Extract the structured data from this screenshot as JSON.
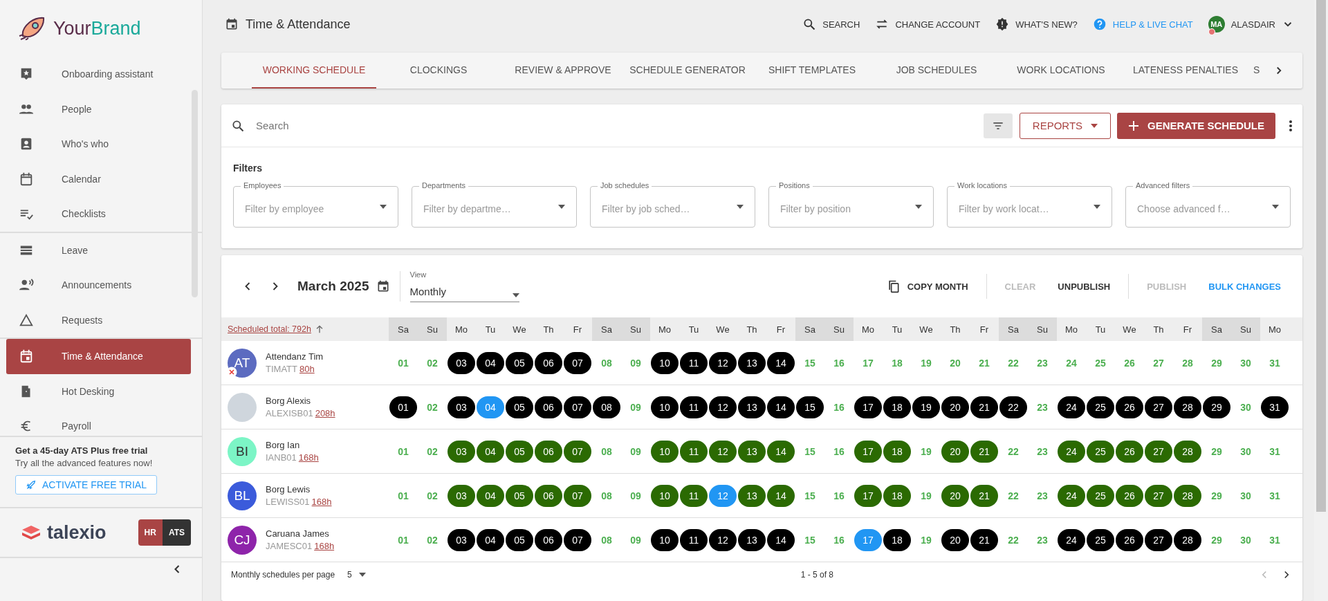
{
  "logo": {
    "first": "Your",
    "second": "Brand"
  },
  "sidebar": {
    "sections": [
      {
        "items": [
          {
            "label": "Onboarding assistant",
            "selected": false
          },
          {
            "label": "People",
            "selected": false
          },
          {
            "label": "Who's who",
            "selected": false
          },
          {
            "label": "Calendar",
            "selected": false
          },
          {
            "label": "Checklists",
            "selected": false
          }
        ]
      },
      {
        "items": [
          {
            "label": "Leave",
            "selected": false
          },
          {
            "label": "Announcements",
            "selected": false
          },
          {
            "label": "Requests",
            "selected": false
          }
        ]
      },
      {
        "items": [
          {
            "label": "Time & Attendance",
            "selected": true
          },
          {
            "label": "Hot Desking",
            "selected": false
          },
          {
            "label": "Payroll",
            "selected": false
          }
        ]
      }
    ]
  },
  "promo": {
    "title": "Get a 45-day ATS Plus free trial",
    "text": "Try all the advanced features now!",
    "button": "ACTIVATE FREE TRIAL"
  },
  "product": {
    "name": "talexio",
    "modules": [
      {
        "label": "HR",
        "selected": true
      },
      {
        "label": "ATS",
        "selected": false
      }
    ]
  },
  "header": {
    "title": "Time & Attendance",
    "actions": [
      {
        "label": "SEARCH",
        "kind": "plain"
      },
      {
        "label": "CHANGE ACCOUNT",
        "kind": "plain"
      },
      {
        "label": "WHAT'S NEW?",
        "kind": "plain"
      },
      {
        "label": "HELP & LIVE CHAT",
        "kind": "link"
      }
    ],
    "user": {
      "initials": "MA",
      "name": "ALASDAIR"
    }
  },
  "tabs": [
    {
      "label": "WORKING SCHEDULE",
      "selected": true
    },
    {
      "label": "CLOCKINGS",
      "selected": false
    },
    {
      "label": "REVIEW & APPROVE",
      "selected": false
    },
    {
      "label": "SCHEDULE GENERATOR",
      "selected": false
    },
    {
      "label": "SHIFT TEMPLATES",
      "selected": false
    },
    {
      "label": "JOB SCHEDULES",
      "selected": false
    },
    {
      "label": "WORK LOCATIONS",
      "selected": false
    },
    {
      "label": "LATENESS PENALTIES",
      "selected": false
    },
    {
      "label": "S",
      "selected": false
    }
  ],
  "search": {
    "placeholder": "Search"
  },
  "reports_button": "REPORTS",
  "generate_button": "GENERATE SCHEDULE",
  "filters": {
    "title": "Filters",
    "fields": [
      {
        "label": "Employees",
        "placeholder": "Filter by employee"
      },
      {
        "label": "Departments",
        "placeholder": "Filter by departme…"
      },
      {
        "label": "Job schedules",
        "placeholder": "Filter by job sched…"
      },
      {
        "label": "Positions",
        "placeholder": "Filter by position"
      },
      {
        "label": "Work locations",
        "placeholder": "Filter by work locat…"
      },
      {
        "label": "Advanced filters",
        "placeholder": "Choose advanced f…"
      }
    ]
  },
  "calendar": {
    "month": "March 2025",
    "view": {
      "label": "View",
      "value": "Monthly"
    },
    "actions": [
      {
        "label": "COPY MONTH",
        "kind": "copy",
        "disabled": false
      },
      {
        "label": "CLEAR",
        "kind": "plain",
        "disabled": true
      },
      {
        "label": "UNPUBLISH",
        "kind": "plain",
        "disabled": false
      },
      {
        "label": "PUBLISH",
        "kind": "plain",
        "disabled": true
      },
      {
        "label": "BULK CHANGES",
        "kind": "link",
        "disabled": false
      }
    ],
    "total": "Scheduled total: 792h",
    "weekdays": [
      {
        "label": "Sa",
        "weekend": true
      },
      {
        "label": "Su",
        "weekend": true
      },
      {
        "label": "Mo",
        "weekend": false
      },
      {
        "label": "Tu",
        "weekend": false
      },
      {
        "label": "We",
        "weekend": false
      },
      {
        "label": "Th",
        "weekend": false
      },
      {
        "label": "Fr",
        "weekend": false
      },
      {
        "label": "Sa",
        "weekend": true
      },
      {
        "label": "Su",
        "weekend": true
      },
      {
        "label": "Mo",
        "weekend": false
      },
      {
        "label": "Tu",
        "weekend": false
      },
      {
        "label": "We",
        "weekend": false
      },
      {
        "label": "Th",
        "weekend": false
      },
      {
        "label": "Fr",
        "weekend": false
      },
      {
        "label": "Sa",
        "weekend": true
      },
      {
        "label": "Su",
        "weekend": true
      },
      {
        "label": "Mo",
        "weekend": false
      },
      {
        "label": "Tu",
        "weekend": false
      },
      {
        "label": "We",
        "weekend": false
      },
      {
        "label": "Th",
        "weekend": false
      },
      {
        "label": "Fr",
        "weekend": false
      },
      {
        "label": "Sa",
        "weekend": true
      },
      {
        "label": "Su",
        "weekend": true
      },
      {
        "label": "Mo",
        "weekend": false
      },
      {
        "label": "Tu",
        "weekend": false
      },
      {
        "label": "We",
        "weekend": false
      },
      {
        "label": "Th",
        "weekend": false
      },
      {
        "label": "Fr",
        "weekend": false
      },
      {
        "label": "Sa",
        "weekend": true
      },
      {
        "label": "Su",
        "weekend": true
      },
      {
        "label": "Mo",
        "weekend": false
      }
    ],
    "employees": [
      {
        "name": "Attendanz Tim",
        "code": "TIMATT",
        "hours": "80h",
        "avatar": {
          "kind": "initials",
          "initials": "AT",
          "color": "#5c6bc0"
        },
        "flagged": true,
        "days": [
          {
            "label": "01",
            "kind": "plain"
          },
          {
            "label": "02",
            "kind": "plain"
          },
          {
            "label": "03",
            "kind": "pill",
            "color": "#000000"
          },
          {
            "label": "04",
            "kind": "pill",
            "color": "#000000"
          },
          {
            "label": "05",
            "kind": "pill",
            "color": "#000000"
          },
          {
            "label": "06",
            "kind": "pill",
            "color": "#000000"
          },
          {
            "label": "07",
            "kind": "pill",
            "color": "#000000"
          },
          {
            "label": "08",
            "kind": "plain"
          },
          {
            "label": "09",
            "kind": "plain"
          },
          {
            "label": "10",
            "kind": "pill",
            "color": "#000000"
          },
          {
            "label": "11",
            "kind": "pill",
            "color": "#000000"
          },
          {
            "label": "12",
            "kind": "pill",
            "color": "#000000"
          },
          {
            "label": "13",
            "kind": "pill",
            "color": "#000000"
          },
          {
            "label": "14",
            "kind": "pill",
            "color": "#000000"
          },
          {
            "label": "15",
            "kind": "plain"
          },
          {
            "label": "16",
            "kind": "plain"
          },
          {
            "label": "17",
            "kind": "plain"
          },
          {
            "label": "18",
            "kind": "plain"
          },
          {
            "label": "19",
            "kind": "plain"
          },
          {
            "label": "20",
            "kind": "plain"
          },
          {
            "label": "21",
            "kind": "plain"
          },
          {
            "label": "22",
            "kind": "plain"
          },
          {
            "label": "23",
            "kind": "plain"
          },
          {
            "label": "24",
            "kind": "plain"
          },
          {
            "label": "25",
            "kind": "plain"
          },
          {
            "label": "26",
            "kind": "plain"
          },
          {
            "label": "27",
            "kind": "plain"
          },
          {
            "label": "28",
            "kind": "plain"
          },
          {
            "label": "29",
            "kind": "plain"
          },
          {
            "label": "30",
            "kind": "plain"
          },
          {
            "label": "31",
            "kind": "plain"
          }
        ]
      },
      {
        "name": "Borg Alexis",
        "code": "ALEXISB01",
        "hours": "208h",
        "avatar": {
          "kind": "photo"
        },
        "flagged": false,
        "days": [
          {
            "label": "01",
            "kind": "pill",
            "color": "#000000"
          },
          {
            "label": "02",
            "kind": "plain"
          },
          {
            "label": "03",
            "kind": "pill",
            "color": "#000000"
          },
          {
            "label": "04",
            "kind": "pill",
            "color": "#2196f3"
          },
          {
            "label": "05",
            "kind": "pill",
            "color": "#000000"
          },
          {
            "label": "06",
            "kind": "pill",
            "color": "#000000"
          },
          {
            "label": "07",
            "kind": "pill",
            "color": "#000000"
          },
          {
            "label": "08",
            "kind": "pill",
            "color": "#000000"
          },
          {
            "label": "09",
            "kind": "plain"
          },
          {
            "label": "10",
            "kind": "pill",
            "color": "#000000"
          },
          {
            "label": "11",
            "kind": "pill",
            "color": "#000000"
          },
          {
            "label": "12",
            "kind": "pill",
            "color": "#000000"
          },
          {
            "label": "13",
            "kind": "pill",
            "color": "#000000"
          },
          {
            "label": "14",
            "kind": "pill",
            "color": "#000000"
          },
          {
            "label": "15",
            "kind": "pill",
            "color": "#000000"
          },
          {
            "label": "16",
            "kind": "plain"
          },
          {
            "label": "17",
            "kind": "pill",
            "color": "#000000"
          },
          {
            "label": "18",
            "kind": "pill",
            "color": "#000000"
          },
          {
            "label": "19",
            "kind": "pill",
            "color": "#000000"
          },
          {
            "label": "20",
            "kind": "pill",
            "color": "#000000"
          },
          {
            "label": "21",
            "kind": "pill",
            "color": "#000000"
          },
          {
            "label": "22",
            "kind": "pill",
            "color": "#000000"
          },
          {
            "label": "23",
            "kind": "plain"
          },
          {
            "label": "24",
            "kind": "pill",
            "color": "#000000"
          },
          {
            "label": "25",
            "kind": "pill",
            "color": "#000000"
          },
          {
            "label": "26",
            "kind": "pill",
            "color": "#000000"
          },
          {
            "label": "27",
            "kind": "pill",
            "color": "#000000"
          },
          {
            "label": "28",
            "kind": "pill",
            "color": "#000000"
          },
          {
            "label": "29",
            "kind": "pill",
            "color": "#000000"
          },
          {
            "label": "30",
            "kind": "plain"
          },
          {
            "label": "31",
            "kind": "pill",
            "color": "#000000"
          }
        ]
      },
      {
        "name": "Borg Ian",
        "code": "IANB01",
        "hours": "168h",
        "avatar": {
          "kind": "initials",
          "initials": "BI",
          "color": "#7cf5c6"
        },
        "flagged": false,
        "days": [
          {
            "label": "01",
            "kind": "plain"
          },
          {
            "label": "02",
            "kind": "plain"
          },
          {
            "label": "03",
            "kind": "pill",
            "color": "#2b6a02"
          },
          {
            "label": "04",
            "kind": "pill",
            "color": "#2b6a02"
          },
          {
            "label": "05",
            "kind": "pill",
            "color": "#2b6a02"
          },
          {
            "label": "06",
            "kind": "pill",
            "color": "#2b6a02"
          },
          {
            "label": "07",
            "kind": "pill",
            "color": "#2b6a02"
          },
          {
            "label": "08",
            "kind": "plain"
          },
          {
            "label": "09",
            "kind": "plain"
          },
          {
            "label": "10",
            "kind": "pill",
            "color": "#2b6a02"
          },
          {
            "label": "11",
            "kind": "pill",
            "color": "#2b6a02"
          },
          {
            "label": "12",
            "kind": "pill",
            "color": "#2b6a02"
          },
          {
            "label": "13",
            "kind": "pill",
            "color": "#2b6a02"
          },
          {
            "label": "14",
            "kind": "pill",
            "color": "#2b6a02"
          },
          {
            "label": "15",
            "kind": "plain"
          },
          {
            "label": "16",
            "kind": "plain"
          },
          {
            "label": "17",
            "kind": "pill",
            "color": "#2b6a02"
          },
          {
            "label": "18",
            "kind": "pill",
            "color": "#2b6a02"
          },
          {
            "label": "19",
            "kind": "plain"
          },
          {
            "label": "20",
            "kind": "pill",
            "color": "#2b6a02"
          },
          {
            "label": "21",
            "kind": "pill",
            "color": "#2b6a02"
          },
          {
            "label": "22",
            "kind": "plain"
          },
          {
            "label": "23",
            "kind": "plain"
          },
          {
            "label": "24",
            "kind": "pill",
            "color": "#2b6a02"
          },
          {
            "label": "25",
            "kind": "pill",
            "color": "#2b6a02"
          },
          {
            "label": "26",
            "kind": "pill",
            "color": "#2b6a02"
          },
          {
            "label": "27",
            "kind": "pill",
            "color": "#2b6a02"
          },
          {
            "label": "28",
            "kind": "pill",
            "color": "#2b6a02"
          },
          {
            "label": "29",
            "kind": "plain"
          },
          {
            "label": "30",
            "kind": "plain"
          },
          {
            "label": "31",
            "kind": "plain"
          }
        ]
      },
      {
        "name": "Borg Lewis",
        "code": "LEWISS01",
        "hours": "168h",
        "avatar": {
          "kind": "initials",
          "initials": "BL",
          "color": "#3b5bdb"
        },
        "flagged": false,
        "days": [
          {
            "label": "01",
            "kind": "plain"
          },
          {
            "label": "02",
            "kind": "plain"
          },
          {
            "label": "03",
            "kind": "pill",
            "color": "#2b6a02"
          },
          {
            "label": "04",
            "kind": "pill",
            "color": "#2b6a02"
          },
          {
            "label": "05",
            "kind": "pill",
            "color": "#2b6a02"
          },
          {
            "label": "06",
            "kind": "pill",
            "color": "#2b6a02"
          },
          {
            "label": "07",
            "kind": "pill",
            "color": "#2b6a02"
          },
          {
            "label": "08",
            "kind": "plain"
          },
          {
            "label": "09",
            "kind": "plain"
          },
          {
            "label": "10",
            "kind": "pill",
            "color": "#2b6a02"
          },
          {
            "label": "11",
            "kind": "pill",
            "color": "#2b6a02"
          },
          {
            "label": "12",
            "kind": "pill",
            "color": "#2196f3"
          },
          {
            "label": "13",
            "kind": "pill",
            "color": "#2b6a02"
          },
          {
            "label": "14",
            "kind": "pill",
            "color": "#2b6a02"
          },
          {
            "label": "15",
            "kind": "plain"
          },
          {
            "label": "16",
            "kind": "plain"
          },
          {
            "label": "17",
            "kind": "pill",
            "color": "#2b6a02"
          },
          {
            "label": "18",
            "kind": "pill",
            "color": "#2b6a02"
          },
          {
            "label": "19",
            "kind": "plain"
          },
          {
            "label": "20",
            "kind": "pill",
            "color": "#2b6a02"
          },
          {
            "label": "21",
            "kind": "pill",
            "color": "#2b6a02"
          },
          {
            "label": "22",
            "kind": "plain"
          },
          {
            "label": "23",
            "kind": "plain"
          },
          {
            "label": "24",
            "kind": "pill",
            "color": "#2b6a02"
          },
          {
            "label": "25",
            "kind": "pill",
            "color": "#2b6a02"
          },
          {
            "label": "26",
            "kind": "pill",
            "color": "#2b6a02"
          },
          {
            "label": "27",
            "kind": "pill",
            "color": "#2b6a02"
          },
          {
            "label": "28",
            "kind": "pill",
            "color": "#2b6a02"
          },
          {
            "label": "29",
            "kind": "plain"
          },
          {
            "label": "30",
            "kind": "plain"
          },
          {
            "label": "31",
            "kind": "plain"
          }
        ]
      },
      {
        "name": "Caruana James",
        "code": "JAMESC01",
        "hours": "168h",
        "avatar": {
          "kind": "initials",
          "initials": "CJ",
          "color": "#8e24aa"
        },
        "flagged": false,
        "days": [
          {
            "label": "01",
            "kind": "plain"
          },
          {
            "label": "02",
            "kind": "plain"
          },
          {
            "label": "03",
            "kind": "pill",
            "color": "#000000"
          },
          {
            "label": "04",
            "kind": "pill",
            "color": "#000000"
          },
          {
            "label": "05",
            "kind": "pill",
            "color": "#000000"
          },
          {
            "label": "06",
            "kind": "pill",
            "color": "#000000"
          },
          {
            "label": "07",
            "kind": "pill",
            "color": "#000000"
          },
          {
            "label": "08",
            "kind": "plain"
          },
          {
            "label": "09",
            "kind": "plain"
          },
          {
            "label": "10",
            "kind": "pill",
            "color": "#000000"
          },
          {
            "label": "11",
            "kind": "pill",
            "color": "#000000"
          },
          {
            "label": "12",
            "kind": "pill",
            "color": "#000000"
          },
          {
            "label": "13",
            "kind": "pill",
            "color": "#000000"
          },
          {
            "label": "14",
            "kind": "pill",
            "color": "#000000"
          },
          {
            "label": "15",
            "kind": "plain"
          },
          {
            "label": "16",
            "kind": "plain"
          },
          {
            "label": "17",
            "kind": "pill",
            "color": "#2196f3"
          },
          {
            "label": "18",
            "kind": "pill",
            "color": "#000000"
          },
          {
            "label": "19",
            "kind": "plain"
          },
          {
            "label": "20",
            "kind": "pill",
            "color": "#000000"
          },
          {
            "label": "21",
            "kind": "pill",
            "color": "#000000"
          },
          {
            "label": "22",
            "kind": "plain"
          },
          {
            "label": "23",
            "kind": "plain"
          },
          {
            "label": "24",
            "kind": "pill",
            "color": "#000000"
          },
          {
            "label": "25",
            "kind": "pill",
            "color": "#000000"
          },
          {
            "label": "26",
            "kind": "pill",
            "color": "#000000"
          },
          {
            "label": "27",
            "kind": "pill",
            "color": "#000000"
          },
          {
            "label": "28",
            "kind": "pill",
            "color": "#000000"
          },
          {
            "label": "29",
            "kind": "plain"
          },
          {
            "label": "30",
            "kind": "plain"
          },
          {
            "label": "31",
            "kind": "plain"
          }
        ]
      }
    ]
  },
  "pagination": {
    "per_page_label": "Monthly schedules per page",
    "per_page": "5",
    "range": "1 - 5 of 8"
  }
}
